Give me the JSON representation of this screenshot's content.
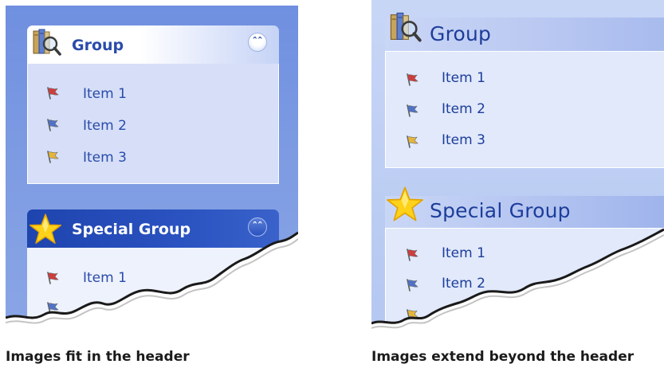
{
  "colors": {
    "panel_left": "#7c9ae2",
    "panel_right": "#b9c9f2",
    "header_text_dark": "#1d3d9a",
    "special_header": "#2448b6",
    "flag_red": "#d03c3c",
    "flag_blue": "#4f72c8",
    "flag_yellow": "#e5b53a",
    "star": "#ffd200"
  },
  "left_panel": {
    "group": {
      "title": "Group",
      "icon": "books-magnifier-icon",
      "toggle_icon": "chevron-double-up-icon",
      "items": [
        {
          "label": "Item 1",
          "icon": "red-flag-icon"
        },
        {
          "label": "Item 2",
          "icon": "blue-flag-icon"
        },
        {
          "label": "Item 3",
          "icon": "yellow-flag-icon"
        }
      ]
    },
    "special_group": {
      "title": "Special Group",
      "icon": "star-icon",
      "toggle_icon": "chevron-double-up-icon",
      "items": [
        {
          "label": "Item 1",
          "icon": "red-flag-icon"
        }
      ]
    },
    "caption": "Images fit in the header"
  },
  "right_panel": {
    "group": {
      "title": "Group",
      "icon": "books-magnifier-icon",
      "items": [
        {
          "label": "Item 1",
          "icon": "red-flag-icon"
        },
        {
          "label": "Item 2",
          "icon": "blue-flag-icon"
        },
        {
          "label": "Item 3",
          "icon": "yellow-flag-icon"
        }
      ]
    },
    "special_group": {
      "title": "Special Group",
      "icon": "star-icon",
      "items": [
        {
          "label": "Item 1",
          "icon": "red-flag-icon"
        },
        {
          "label": "Item 2",
          "icon": "blue-flag-icon"
        }
      ]
    },
    "caption": "Images extend beyond the header"
  }
}
